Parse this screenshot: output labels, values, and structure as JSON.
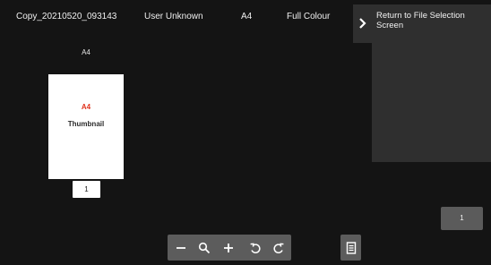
{
  "header": {
    "file_name": "Copy_20210520_093143",
    "user": "User Unknown",
    "paper_size": "A4",
    "colour_mode": "Full Colour"
  },
  "return_panel": {
    "label": "Return to File Selection Screen",
    "icon": "chevron-right-icon"
  },
  "preview": {
    "caption": "A4",
    "thumbnail_paper": "A4",
    "thumbnail_label": "Thumbnail",
    "page_number": "1"
  },
  "page_button": {
    "label": "1"
  },
  "toolbar": {
    "icons": [
      "zoom-out-icon",
      "magnifier-icon",
      "zoom-in-icon",
      "rotate-left-icon",
      "rotate-right-icon",
      "document-list-icon"
    ]
  },
  "colors": {
    "background": "#141414",
    "panel": "#2f2f2f",
    "button": "#5c5c5c",
    "thumbnail_accent": "#e0331e"
  }
}
